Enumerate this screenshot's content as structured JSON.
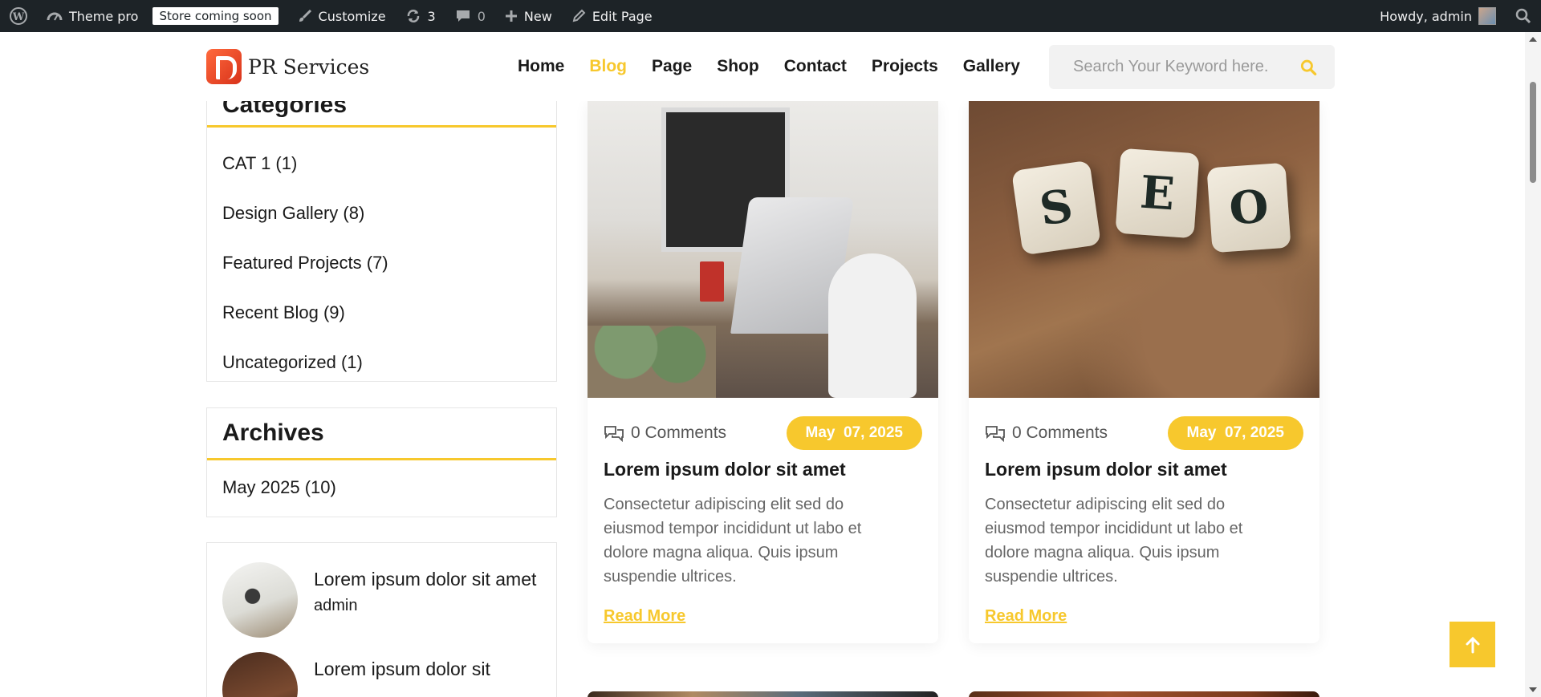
{
  "admin_bar": {
    "site_name": "Theme pro",
    "store_badge": "Store coming soon",
    "customize": "Customize",
    "updates_count": "3",
    "comments_count": "0",
    "new_label": "New",
    "edit_page": "Edit Page",
    "greeting": "Howdy, admin"
  },
  "header": {
    "logo_text": "PR Services",
    "nav": [
      "Home",
      "Blog",
      "Page",
      "Shop",
      "Contact",
      "Projects",
      "Gallery"
    ],
    "active_nav": "Blog",
    "search_placeholder": "Search Your Keyword here."
  },
  "sidebar": {
    "categories": {
      "title": "Categories",
      "items": [
        "CAT 1 (1)",
        "Design Gallery (8)",
        "Featured Projects (7)",
        "Recent Blog (9)",
        "Uncategorized (1)"
      ]
    },
    "archives": {
      "title": "Archives",
      "items": [
        "May 2025 (10)"
      ]
    },
    "recent_posts": [
      {
        "title": "Lorem ipsum dolor sit amet",
        "author": "admin"
      },
      {
        "title": "Lorem ipsum dolor sit"
      }
    ]
  },
  "posts": [
    {
      "comments": "0 Comments",
      "date": "May  07, 2025",
      "title": "Lorem ipsum dolor sit amet",
      "excerpt": "Consectetur adipiscing elit sed do eiusmod tempor incididunt ut labo et dolore magna aliqua. Quis ipsum suspendie ultrices.",
      "read_more": "Read More"
    },
    {
      "comments": "0 Comments",
      "date": "May  07, 2025",
      "title": "Lorem ipsum dolor sit amet",
      "excerpt": "Consectetur adipiscing elit sed do eiusmod tempor incididunt ut labo et dolore magna aliqua. Quis ipsum suspendie ultrices.",
      "read_more": "Read More",
      "image_letters": [
        "S",
        "E",
        "O"
      ]
    }
  ],
  "colors": {
    "accent": "#f7c82d",
    "admin_bar": "#1d2327"
  }
}
